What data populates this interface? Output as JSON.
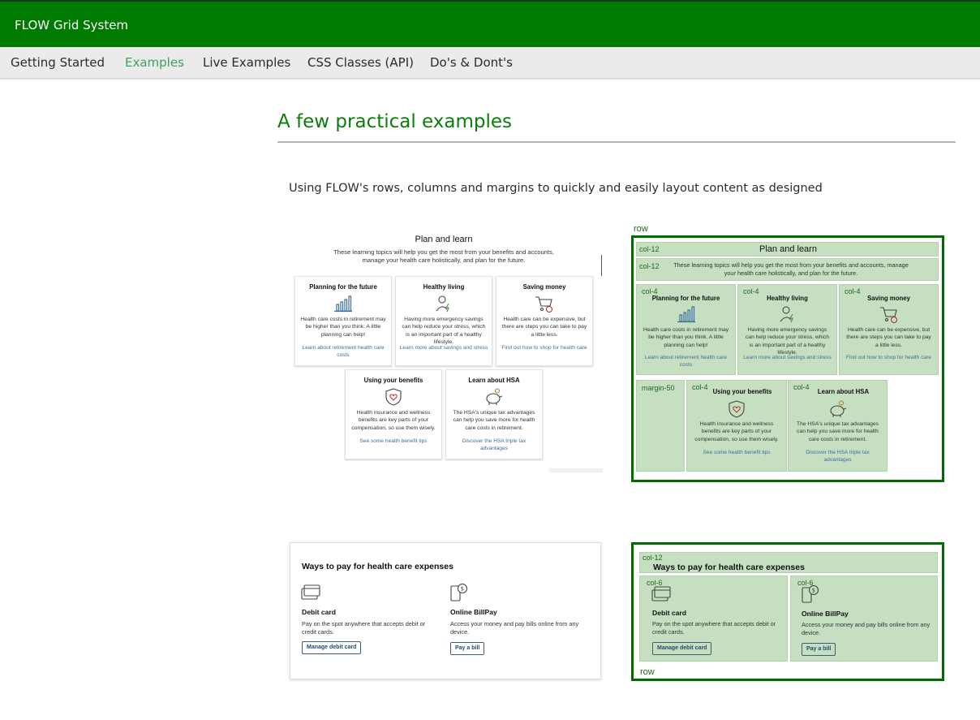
{
  "app": {
    "brand": "FLOW Grid System"
  },
  "nav": {
    "items": [
      {
        "label": "Getting Started"
      },
      {
        "label": "Examples"
      },
      {
        "label": "Live Examples"
      },
      {
        "label": "CSS Classes (API)"
      },
      {
        "label": "Do's & Dont's"
      }
    ],
    "active_index": 1
  },
  "page": {
    "title": "A few practical examples",
    "intro": "Using FLOW's rows, columns and margins to quickly and easily layout content as designed"
  },
  "example1": {
    "heading": "Plan and learn",
    "description": "These learning topics will help you get the most from your benefits and accounts, manage your health care holistically, and plan for the future.",
    "cards": [
      {
        "title": "Planning for the future",
        "icon": "bar-chart-icon",
        "text": "Health care costs in retirement may be higher than you think. A little planning can help!",
        "link": "Learn about retirement health care costs"
      },
      {
        "title": "Healthy living",
        "icon": "person-energy-icon",
        "text": "Having more emergency savings can help reduce your stress, which is an important part of a healthy lifestyle.",
        "link": "Learn more about savings and stress"
      },
      {
        "title": "Saving money",
        "icon": "shopping-cart-icon",
        "text": "Health care can be expensive, but there are steps you can take to pay a little less.",
        "link": "Find out how to shop for health care"
      },
      {
        "title": "Using your benefits",
        "icon": "shield-heart-icon",
        "text": "Health insurance and wellness benefits are key parts of your compensation, so use them wisely.",
        "link": "See some health benefit tips"
      },
      {
        "title": "Learn about HSA",
        "icon": "piggy-bank-icon",
        "text": "The HSA's unique tax advantages can help you save more for health care costs in retirement.",
        "link": "Discover the HSA triple tax advantages"
      }
    ],
    "annotations": {
      "row": "row",
      "col12": "col-12",
      "col4": "col-4",
      "margin": "margin-50"
    }
  },
  "example2": {
    "heading": "Ways to pay for health care expenses",
    "cards": [
      {
        "title": "Debit card",
        "icon": "debit-card-icon",
        "text": "Pay on the spot anywhere that accepts debit or credit cards.",
        "button": "Manage debit card"
      },
      {
        "title": "Online BillPay",
        "icon": "mobile-pay-icon",
        "text": "Access your money and pay bills online from any device.",
        "button": "Pay a bill"
      }
    ],
    "annotations": {
      "row": "row",
      "col12": "col-12",
      "col6": "col-6"
    }
  },
  "colors": {
    "brand_green": "#007a00",
    "title_green": "#0a7d0a",
    "nav_active": "#3aa35a",
    "annotation_fill": "#c6dfc1",
    "annotation_border": "#006b00",
    "link_blue": "#3d6e9e"
  }
}
